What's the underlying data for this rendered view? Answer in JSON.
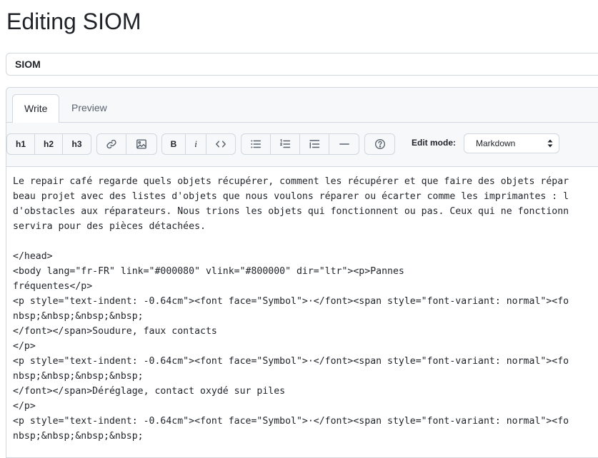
{
  "page": {
    "title": "Editing SIOM"
  },
  "title_field": {
    "value": "SIOM"
  },
  "tabs": [
    {
      "label": "Write",
      "active": true
    },
    {
      "label": "Preview",
      "active": false
    }
  ],
  "toolbar": {
    "h1": "h1",
    "h2": "h2",
    "h3": "h3",
    "bold": "B",
    "italic": "i",
    "edit_mode_label": "Edit mode:",
    "edit_mode_value": "Markdown",
    "icons": [
      "link-icon",
      "image-icon",
      "code-icon",
      "bullet-list-icon",
      "numbered-list-icon",
      "task-list-icon",
      "horizontal-rule-icon",
      "help-icon"
    ]
  },
  "editor": {
    "lines": [
      "Le repair café regarde quels objets récupérer, comment les récupérer et que faire des objets répar",
      "beau projet avec des listes d'objets que nous voulons réparer ou écarter comme les imprimantes : l",
      "d'obstacles aux réparateurs. Nous trions les objets qui fonctionnent ou pas. Ceux qui ne fonctionn",
      "servira pour des pièces détachées.",
      "",
      "</head>",
      "<body lang=\"fr-FR\" link=\"#000080\" vlink=\"#800000\" dir=\"ltr\"><p>Pannes",
      "fréquentes</p>",
      "<p style=\"text-indent: -0.64cm\"><font face=\"Symbol\">·</font><span style=\"font-variant: normal\"><fo",
      "nbsp;&nbsp;&nbsp;&nbsp;",
      "</font></span>Soudure, faux contacts",
      "</p>",
      "<p style=\"text-indent: -0.64cm\"><font face=\"Symbol\">·</font><span style=\"font-variant: normal\"><fo",
      "nbsp;&nbsp;&nbsp;&nbsp;",
      "</font></span>Déréglage, contact oxydé sur piles",
      "</p>",
      "<p style=\"text-indent: -0.64cm\"><font face=\"Symbol\">·</font><span style=\"font-variant: normal\"><fo",
      "nbsp;&nbsp;&nbsp;&nbsp;"
    ]
  }
}
